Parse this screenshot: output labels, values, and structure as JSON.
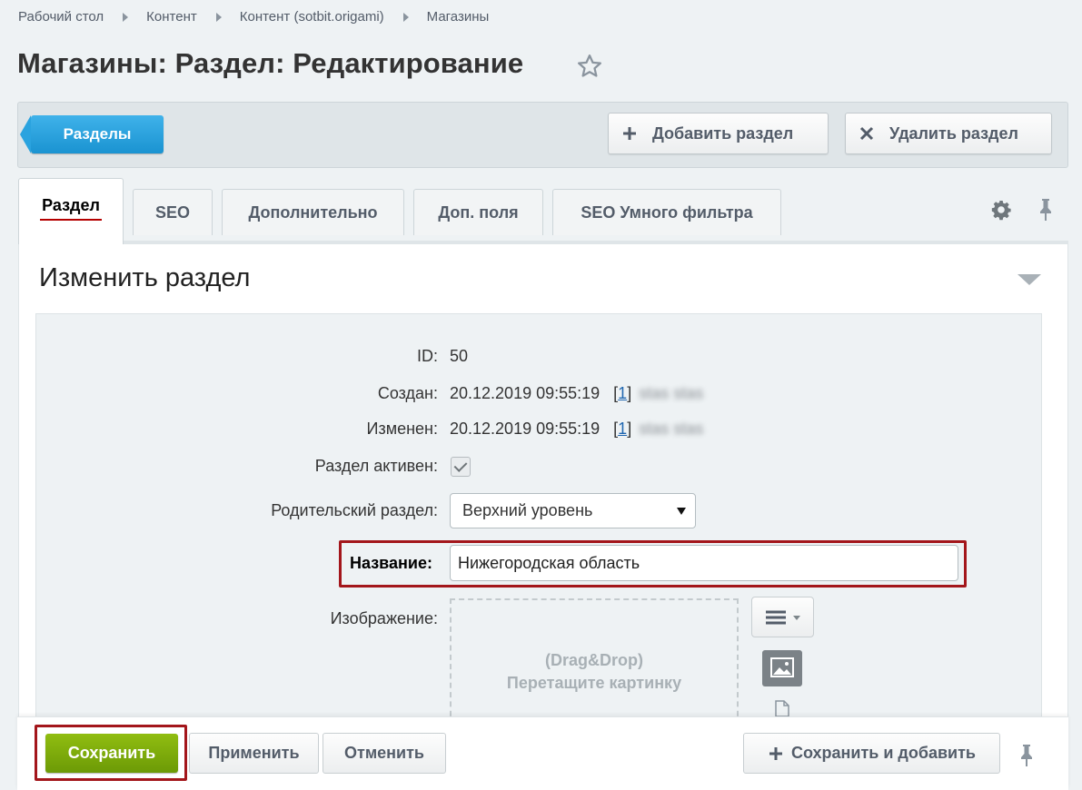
{
  "breadcrumb": [
    "Рабочий стол",
    "Контент",
    "Контент (sotbit.origami)",
    "Магазины"
  ],
  "page_title": "Магазины: Раздел: Редактирование",
  "toolbar": {
    "sections_label": "Разделы",
    "add_section_label": "Добавить раздел",
    "delete_section_label": "Удалить раздел"
  },
  "tabs": [
    {
      "label": "Раздел",
      "active": true
    },
    {
      "label": "SEO"
    },
    {
      "label": "Дополнительно"
    },
    {
      "label": "Доп. поля"
    },
    {
      "label": "SEO Умного фильтра"
    }
  ],
  "panel": {
    "title": "Изменить раздел"
  },
  "form": {
    "id_label": "ID:",
    "id_value": "50",
    "created_label": "Создан:",
    "created_value": "20.12.2019 09:55:19",
    "created_user_link": "1",
    "created_user_name": "stas stas",
    "modified_label": "Изменен:",
    "modified_value": "20.12.2019 09:55:19",
    "modified_user_link": "1",
    "modified_user_name": "stas stas",
    "active_label": "Раздел активен:",
    "active_checked": true,
    "parent_label": "Родительский раздел:",
    "parent_value": "Верхний уровень",
    "name_label": "Название:",
    "name_value": "Нижегородская область",
    "image_label": "Изображение:",
    "dropzone_line1": "(Drag&Drop)",
    "dropzone_line2": "Перетащите картинку"
  },
  "footer": {
    "save_label": "Сохранить",
    "apply_label": "Применить",
    "cancel_label": "Отменить",
    "save_add_label": "Сохранить и добавить"
  },
  "colors": {
    "accent_blue": "#1a93d1",
    "save_green": "#7aa60b",
    "highlight_red": "#a3161b"
  }
}
